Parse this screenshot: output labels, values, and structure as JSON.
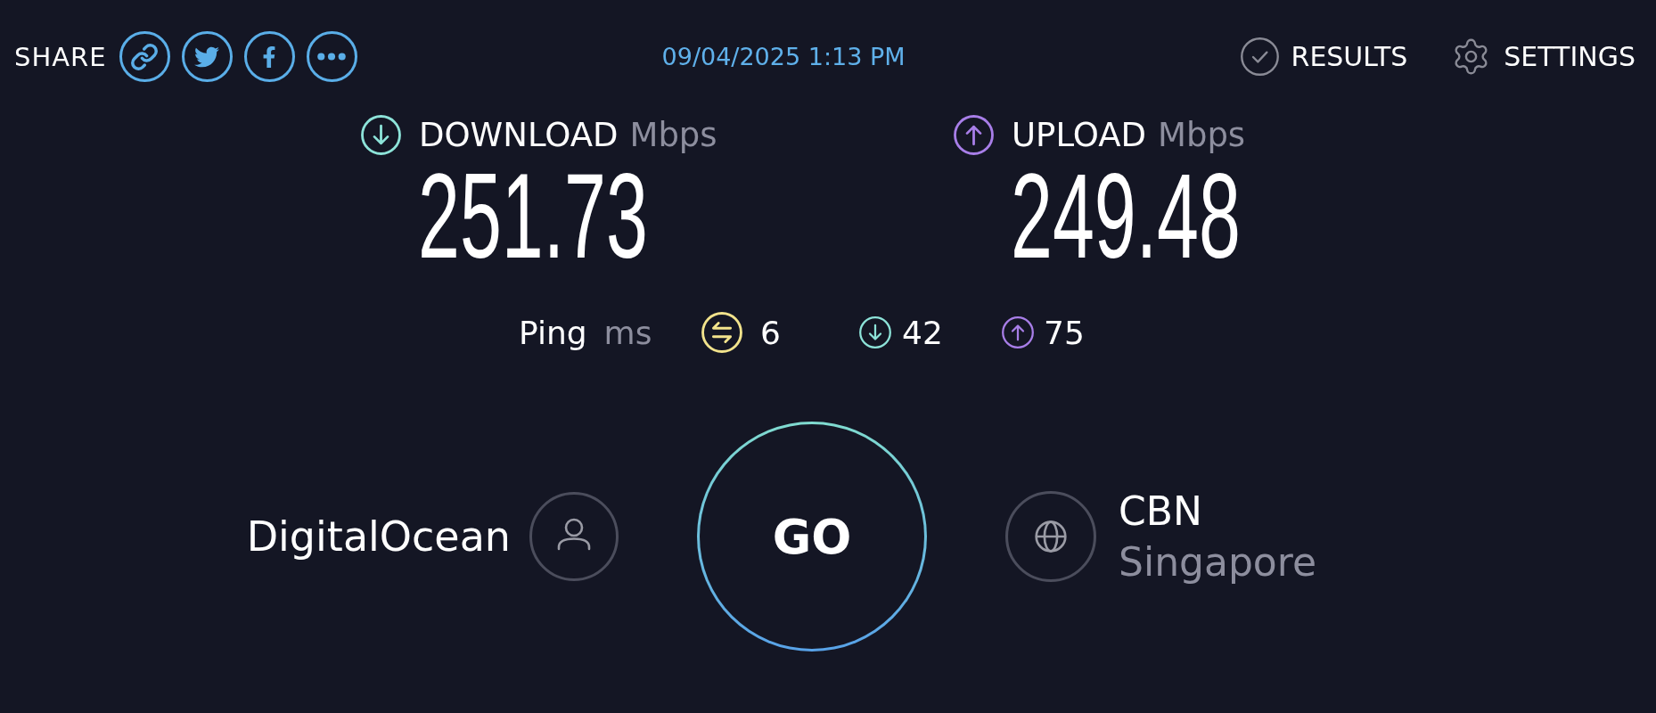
{
  "share": {
    "label": "SHARE",
    "buttons": [
      {
        "kind": "link"
      },
      {
        "kind": "twitter"
      },
      {
        "kind": "facebook"
      },
      {
        "kind": "more"
      }
    ]
  },
  "timestamp": "09/04/2025 1:13 PM",
  "nav": [
    {
      "kind": "results",
      "label": "RESULTS"
    },
    {
      "kind": "settings",
      "label": "SETTINGS"
    }
  ],
  "metrics": [
    {
      "kind": "download",
      "label": "DOWNLOAD",
      "unit": "Mbps",
      "value": "251.73"
    },
    {
      "kind": "upload",
      "label": "UPLOAD",
      "unit": "Mbps",
      "value": "249.48"
    }
  ],
  "ping": {
    "label": "Ping",
    "unit": "ms",
    "readings": [
      {
        "kind": "idle",
        "value": "6"
      },
      {
        "kind": "download",
        "value": "42"
      },
      {
        "kind": "upload",
        "value": "75"
      }
    ]
  },
  "go_button": {
    "label": "GO"
  },
  "provider": {
    "name": "DigitalOcean"
  },
  "server": {
    "name": "CBN",
    "location": "Singapore"
  }
}
